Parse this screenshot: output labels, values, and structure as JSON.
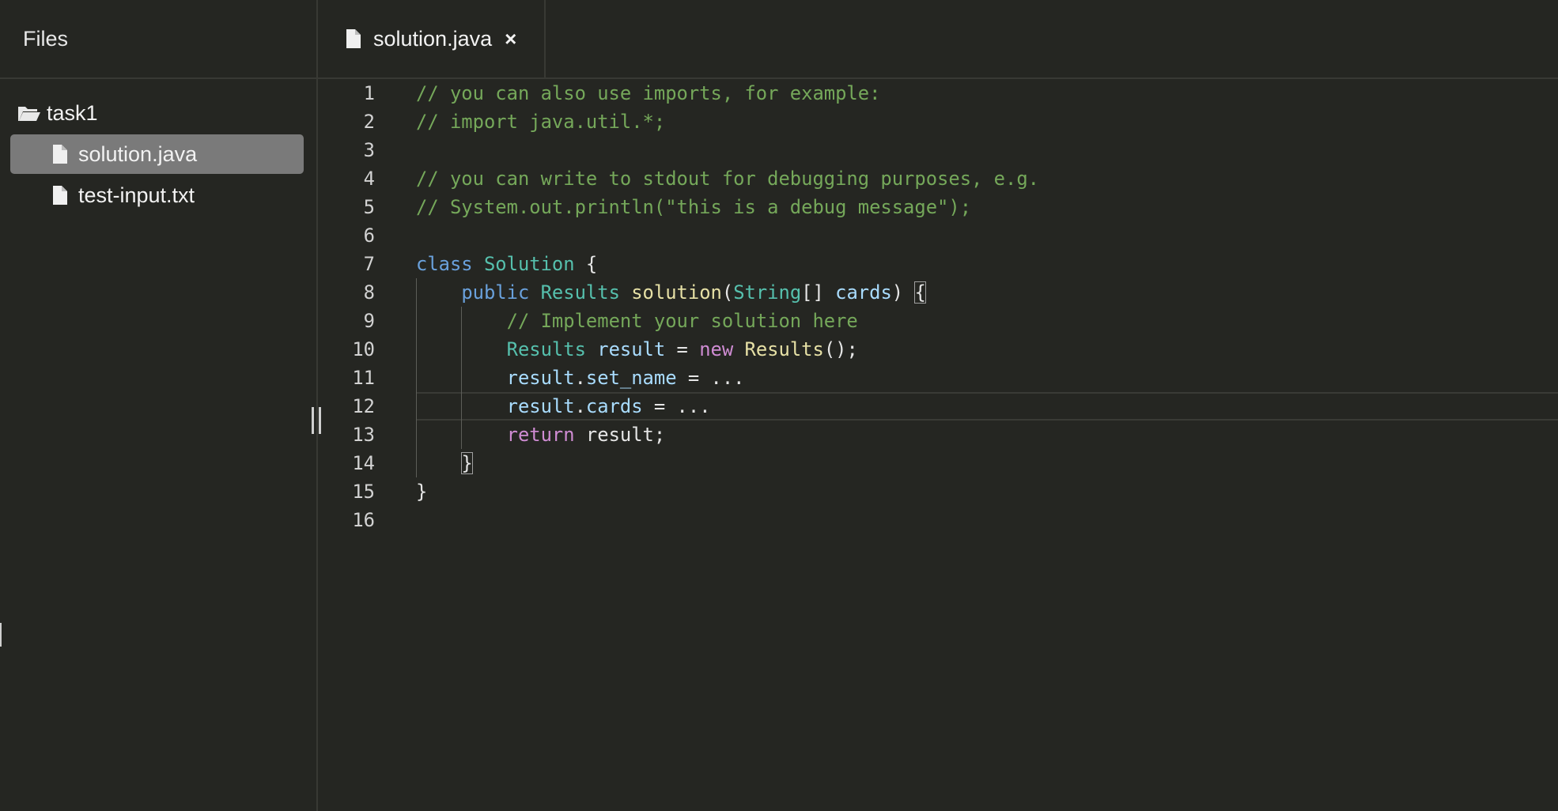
{
  "sidebar": {
    "title": "Files",
    "folder": "task1",
    "files": [
      {
        "label": "solution.java",
        "selected": true
      },
      {
        "label": "test-input.txt",
        "selected": false
      }
    ]
  },
  "tabs": [
    {
      "label": "solution.java",
      "close": "×"
    }
  ],
  "editor": {
    "active_line": 12,
    "line_numbers": [
      "1",
      "2",
      "3",
      "4",
      "5",
      "6",
      "7",
      "8",
      "9",
      "10",
      "11",
      "12",
      "13",
      "14",
      "15",
      "16"
    ],
    "lines": [
      "// you can also use imports, for example:",
      "// import java.util.*;",
      "",
      "// you can write to stdout for debugging purposes, e.g.",
      "// System.out.println(\"this is a debug message\");",
      "",
      "class Solution {",
      "    public Results solution(String[] cards) {",
      "        // Implement your solution here",
      "        Results result = new Results();",
      "        result.set_name = ...",
      "        result.cards = ...",
      "        return result;",
      "    }",
      "}",
      ""
    ]
  },
  "colors": {
    "background": "#252622",
    "comment": "#75a85a",
    "keyword": "#6aa1dc",
    "type": "#56c0ad",
    "function": "#e7e1a6",
    "variable": "#a9dcfe",
    "control": "#cf8cd3",
    "selected_row": "#7a7a7a"
  }
}
